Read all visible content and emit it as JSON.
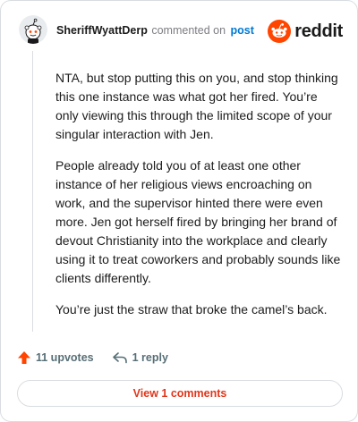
{
  "comment": {
    "author": "SheriffWyattDerp",
    "action_text": "commented on",
    "post_link": "post",
    "paragraphs": [
      "NTA, but stop putting this on you, and stop thinking this one instance was what got her fired. You’re only viewing this through the limited scope of your singular interaction with Jen.",
      "People already told you of at least one other instance of her religious views encroaching on work, and the supervisor hinted there were even more. Jen got herself fired by bringing her brand of devout Christianity into the workplace and clearly using it to treat coworkers and probably sounds like clients differently.",
      "You’re just the straw that broke the camel’s back."
    ]
  },
  "brand": {
    "logo_text": "reddit",
    "accent_color": "#ff4500",
    "link_color": "#0079d3"
  },
  "actions": {
    "upvotes": "11 upvotes",
    "replies": "1 reply"
  },
  "footer": {
    "view_comments": "View 1 comments"
  },
  "icons": [
    "avatar-snoo",
    "reddit-logo-icon",
    "upvote-arrow-icon",
    "reply-icon"
  ]
}
